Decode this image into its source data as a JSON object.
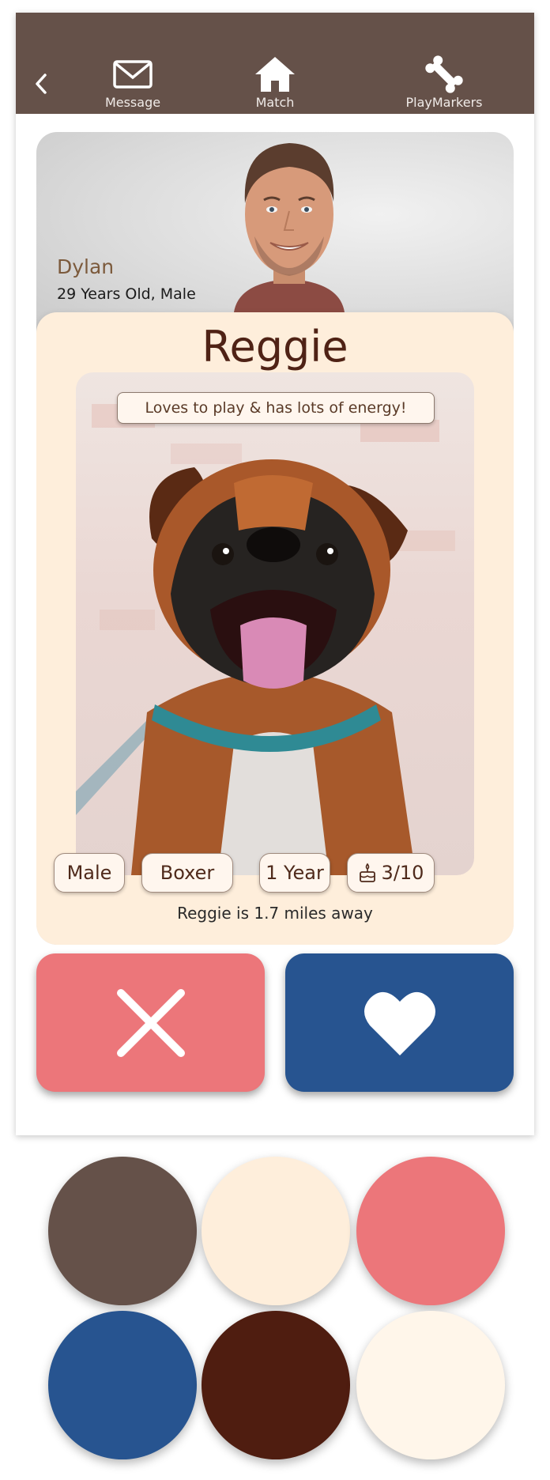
{
  "nav": {
    "items": [
      {
        "label": "Message",
        "icon": "mail-icon"
      },
      {
        "label": "Match",
        "icon": "home-icon"
      },
      {
        "label": "PlayMarkers",
        "icon": "bone-icon"
      }
    ],
    "back_icon": "chevron-left-icon"
  },
  "owner": {
    "name": "Dylan",
    "details": "29 Years Old, Male"
  },
  "pet": {
    "name": "Reggie",
    "tagline": "Loves to play & has lots of energy!",
    "chips": {
      "sex": "Male",
      "breed": "Boxer",
      "age": "1 Year",
      "energy": "3/10"
    },
    "distance": "Reggie is 1.7 miles away"
  },
  "actions": {
    "reject_icon": "x-icon",
    "like_icon": "heart-icon"
  },
  "palette": [
    "#655149",
    "#feeedb",
    "#ec767a",
    "#275490",
    "#4f1d10",
    "#fff6ea"
  ]
}
